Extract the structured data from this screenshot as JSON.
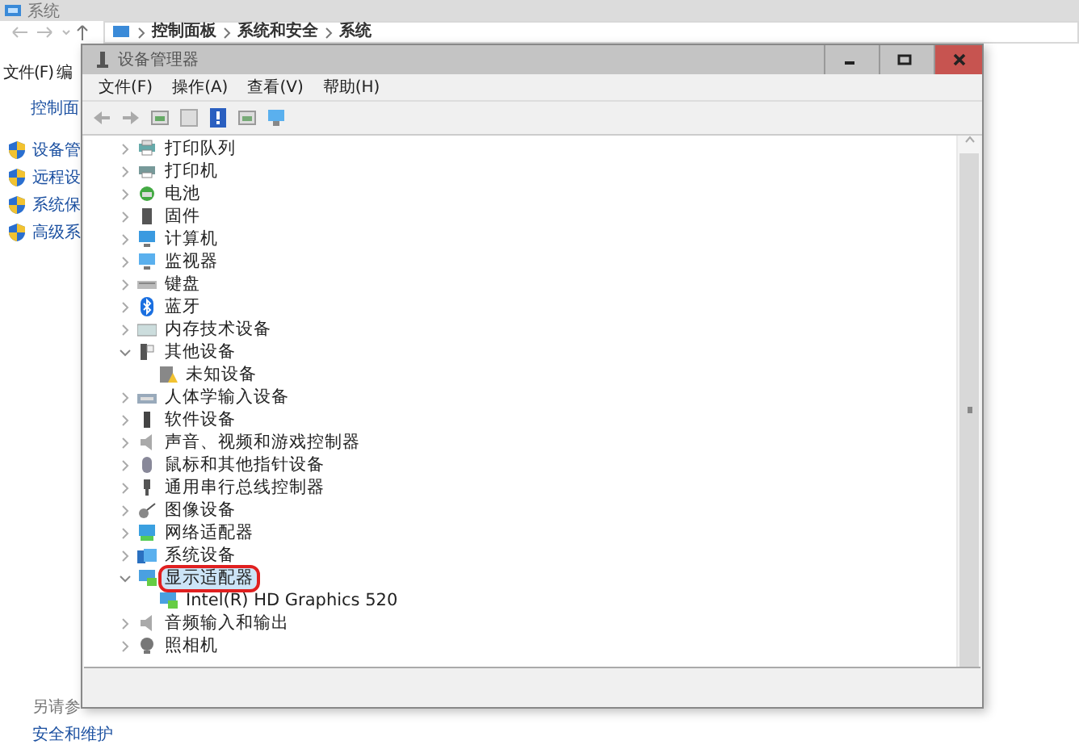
{
  "background_window": {
    "title": "系统",
    "breadcrumbs": [
      "控制面板",
      "系统和安全",
      "系统"
    ],
    "menu": [
      "文件(F)",
      "编"
    ],
    "sidebar": {
      "home_link": "控制面",
      "links": [
        "设备管",
        "远程设",
        "系统保",
        "高级系"
      ],
      "see_also_heading": "另请参",
      "see_also_links": [
        "安全和维护"
      ]
    }
  },
  "device_manager": {
    "title": "设备管理器",
    "menu": [
      "文件(F)",
      "操作(A)",
      "查看(V)",
      "帮助(H)"
    ],
    "tree": [
      {
        "label": "打印队列",
        "expanded": false,
        "selected": false,
        "circled": false
      },
      {
        "label": "打印机",
        "expanded": false,
        "selected": false,
        "circled": false
      },
      {
        "label": "电池",
        "expanded": false,
        "selected": false,
        "circled": false
      },
      {
        "label": "固件",
        "expanded": false,
        "selected": false,
        "circled": false
      },
      {
        "label": "计算机",
        "expanded": false,
        "selected": false,
        "circled": false
      },
      {
        "label": "监视器",
        "expanded": false,
        "selected": false,
        "circled": false
      },
      {
        "label": "键盘",
        "expanded": false,
        "selected": false,
        "circled": false
      },
      {
        "label": "蓝牙",
        "expanded": false,
        "selected": false,
        "circled": false
      },
      {
        "label": "内存技术设备",
        "expanded": false,
        "selected": false,
        "circled": false
      },
      {
        "label": "其他设备",
        "expanded": true,
        "selected": false,
        "circled": false,
        "children": [
          {
            "label": "未知设备"
          }
        ]
      },
      {
        "label": "人体学输入设备",
        "expanded": false,
        "selected": false,
        "circled": false
      },
      {
        "label": "软件设备",
        "expanded": false,
        "selected": false,
        "circled": false
      },
      {
        "label": "声音、视频和游戏控制器",
        "expanded": false,
        "selected": false,
        "circled": false
      },
      {
        "label": "鼠标和其他指针设备",
        "expanded": false,
        "selected": false,
        "circled": false
      },
      {
        "label": "通用串行总线控制器",
        "expanded": false,
        "selected": false,
        "circled": false
      },
      {
        "label": "图像设备",
        "expanded": false,
        "selected": false,
        "circled": false
      },
      {
        "label": "网络适配器",
        "expanded": false,
        "selected": false,
        "circled": false
      },
      {
        "label": "系统设备",
        "expanded": false,
        "selected": false,
        "circled": false
      },
      {
        "label": "显示适配器",
        "expanded": true,
        "selected": true,
        "circled": true,
        "children": [
          {
            "label": "Intel(R) HD Graphics 520"
          }
        ]
      },
      {
        "label": "音频输入和输出",
        "expanded": false,
        "selected": false,
        "circled": false
      },
      {
        "label": "照相机",
        "expanded": false,
        "selected": false,
        "circled": false
      }
    ]
  }
}
